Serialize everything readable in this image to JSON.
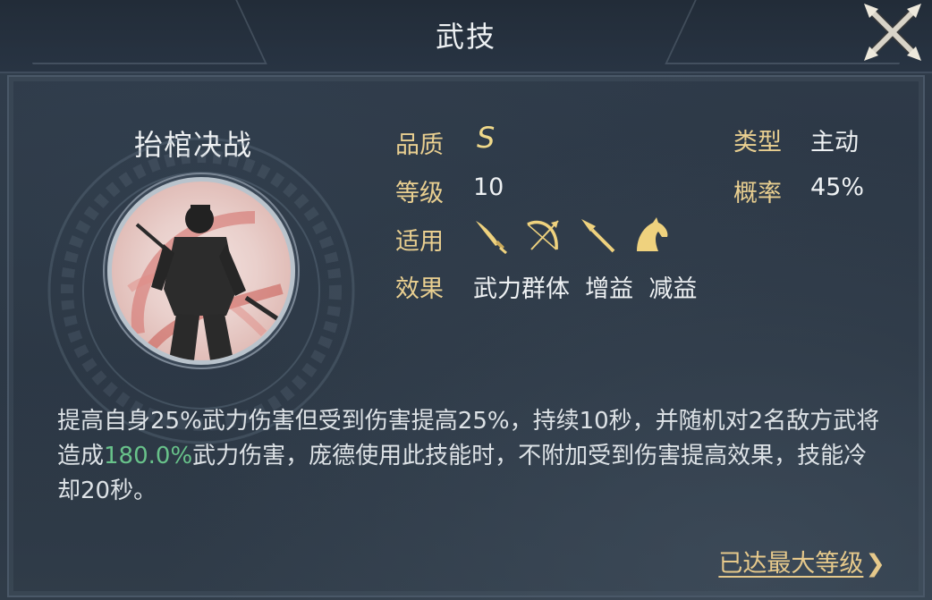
{
  "header": {
    "title": "武技"
  },
  "skill": {
    "name": "抬棺决战",
    "quality_label": "品质",
    "quality_value": "S",
    "level_label": "等级",
    "level_value": "10",
    "applicable_label": "适用",
    "applicable_icons": [
      "sword-icon",
      "bow-icon",
      "spear-icon",
      "horse-icon"
    ],
    "effect_label": "效果",
    "effect_value": "武力群体  增益  减益",
    "type_label": "类型",
    "type_value": "主动",
    "chance_label": "概率",
    "chance_value": "45%"
  },
  "description": {
    "part1": "提高自身25%武力伤害但受到伤害提高25%，持续10秒，并随机对2名敌方武将造成",
    "highlight": "180.0%",
    "part2": "武力伤害，庞德使用此技能时，不附加受到伤害提高效果，技能冷却20秒。"
  },
  "footer": {
    "max_level_link": "已达最大等级"
  },
  "colors": {
    "label": "#e9cf90",
    "highlight": "#68c28a",
    "accent": "#f0d98a"
  }
}
